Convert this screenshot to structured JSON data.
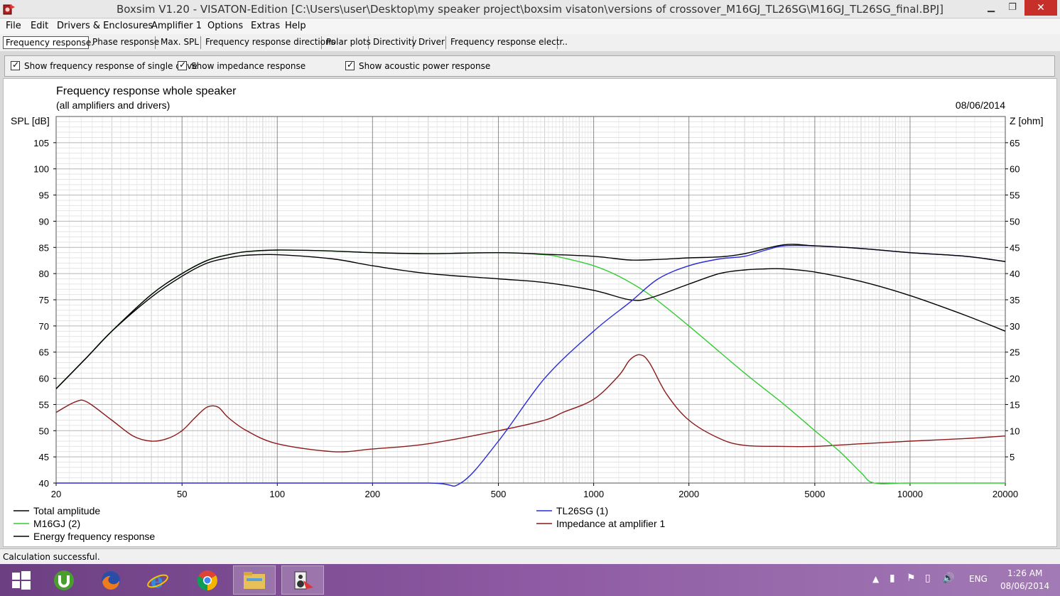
{
  "window": {
    "title": "Boxsim V1.20 - VISATON-Edition [C:\\Users\\user\\Desktop\\my speaker project\\boxsim visaton\\versions of crossover_M16GJ_TL26SG\\M16GJ_TL26SG_final.BPJ]",
    "minimize_glyph": "▁",
    "maximize_glyph": "❐",
    "close_glyph": "✕"
  },
  "menu": [
    "File",
    "Edit",
    "Drivers & Enclosures",
    "Amplifier 1",
    "Options",
    "Extras",
    "Help"
  ],
  "tabs": [
    "Frequency response.",
    "Phase response",
    "Max. SPL",
    "Frequency response directions",
    "Polar plots",
    "Directivity",
    "Driver",
    "Frequency response electr.."
  ],
  "options": {
    "single_drive": {
      "label": "Show frequency response of single drive",
      "checked": true
    },
    "impedance": {
      "label": "Show impedance response",
      "checked": true
    },
    "acoustic_power": {
      "label": "Show acoustic power response",
      "checked": true
    }
  },
  "status": "Calculation successful.",
  "taskbar": {
    "icons": [
      "windows-start-icon",
      "utorrent-icon",
      "firefox-icon",
      "internet-explorer-icon",
      "chrome-icon",
      "file-explorer-icon",
      "boxsim-icon"
    ],
    "language": "ENG",
    "time": "1:26 AM",
    "date": "08/06/2014"
  },
  "chart_data": {
    "type": "line",
    "title": "Frequency response whole speaker",
    "subtitle": "(all amplifiers and drivers)",
    "date": "08/06/2014",
    "xlabel": "",
    "ylabel": "SPL [dB]",
    "y2label": "Z [ohm]",
    "xscale": "log",
    "xlim": [
      20,
      20000
    ],
    "ylim": [
      40,
      110
    ],
    "y2lim": [
      0,
      70
    ],
    "xticks": [
      20,
      50,
      100,
      200,
      500,
      1000,
      2000,
      5000,
      10000,
      20000
    ],
    "yticks": [
      40,
      45,
      50,
      55,
      60,
      65,
      70,
      75,
      80,
      85,
      90,
      95,
      100,
      105
    ],
    "y2ticks": [
      5,
      10,
      15,
      20,
      25,
      30,
      35,
      40,
      45,
      50,
      55,
      60,
      65
    ],
    "grid": true,
    "legend_position": "bottom",
    "series": [
      {
        "name": "Total amplitude",
        "color": "#000000",
        "axis": "left",
        "x": [
          20,
          25,
          30,
          40,
          50,
          60,
          70,
          80,
          100,
          150,
          200,
          300,
          500,
          700,
          1000,
          1300,
          1600,
          2000,
          2500,
          3000,
          4000,
          5000,
          7000,
          10000,
          15000,
          20000
        ],
        "y": [
          58,
          64,
          69,
          76,
          80,
          82.5,
          83.6,
          84.2,
          84.5,
          84.3,
          84,
          83.8,
          84,
          83.7,
          83.3,
          82.6,
          82.7,
          83,
          83.2,
          83.8,
          85.5,
          85.3,
          84.8,
          84,
          83.3,
          82.3
        ]
      },
      {
        "name": "M16GJ (2)",
        "color": "#33cc33",
        "axis": "left",
        "x": [
          20,
          25,
          30,
          40,
          50,
          60,
          70,
          80,
          100,
          150,
          200,
          300,
          500,
          700,
          800,
          1000,
          1200,
          1500,
          2000,
          3000,
          4000,
          5000,
          6000,
          7000,
          7700,
          10000,
          20000
        ],
        "y": [
          58,
          64,
          69,
          76,
          80,
          82.5,
          83.6,
          84.2,
          84.5,
          84.3,
          84,
          83.8,
          84,
          83.6,
          83,
          81.5,
          79.5,
          76,
          70,
          61,
          55,
          50,
          46,
          42,
          40,
          40,
          40
        ]
      },
      {
        "name": "Energy frequency response",
        "color": "#000000",
        "axis": "left",
        "x": [
          20,
          25,
          30,
          40,
          50,
          60,
          70,
          80,
          100,
          150,
          200,
          300,
          500,
          700,
          1000,
          1300,
          1500,
          2000,
          2500,
          3000,
          3500,
          4000,
          5000,
          7000,
          10000,
          15000,
          20000
        ],
        "y": [
          58,
          64,
          69,
          75.5,
          79.5,
          82,
          83,
          83.5,
          83.6,
          82.8,
          81.5,
          80,
          79,
          78.3,
          76.8,
          75,
          75.3,
          78,
          80,
          80.7,
          80.9,
          80.9,
          80.3,
          78.5,
          75.8,
          72,
          69
        ]
      },
      {
        "name": "TL26SG (1)",
        "color": "#2a2ad8",
        "axis": "left",
        "x": [
          20,
          100,
          300,
          380,
          500,
          700,
          1000,
          1300,
          1600,
          2000,
          2500,
          3000,
          3500,
          4000,
          5000,
          7000,
          10000,
          15000,
          20000
        ],
        "y": [
          40,
          40,
          40,
          40,
          48,
          60,
          69,
          74.5,
          79,
          81.5,
          82.8,
          83.3,
          84.5,
          85.3,
          85.3,
          84.8,
          84,
          83.3,
          82.3
        ]
      },
      {
        "name": "Impedance at amplifier 1",
        "color": "#8b1a1a",
        "axis": "right",
        "x": [
          20,
          23,
          25,
          30,
          35,
          40,
          45,
          50,
          55,
          60,
          65,
          70,
          80,
          100,
          150,
          200,
          300,
          500,
          700,
          800,
          1000,
          1200,
          1300,
          1400,
          1500,
          1700,
          2000,
          2500,
          3000,
          4000,
          5000,
          7000,
          10000,
          15000,
          20000
        ],
        "y": [
          13.5,
          15.5,
          15.5,
          12,
          9,
          8,
          8.5,
          10,
          12.5,
          14.5,
          14.5,
          12.5,
          10,
          7.5,
          6,
          6.5,
          7.5,
          10,
          12,
          13.5,
          16,
          20.5,
          23.5,
          24.5,
          23,
          17,
          12,
          8.5,
          7.2,
          7,
          7,
          7.5,
          8,
          8.5,
          9
        ]
      }
    ]
  }
}
